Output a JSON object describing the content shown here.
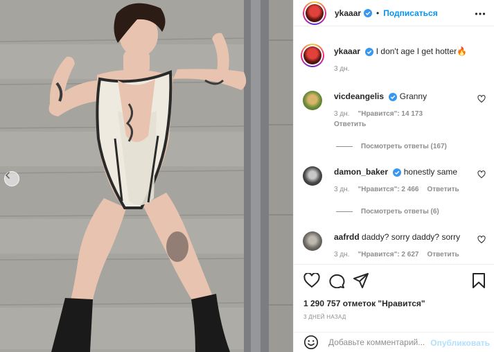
{
  "header": {
    "username": "ykaaar",
    "separator": "•",
    "follow_label": "Подписаться"
  },
  "caption": {
    "username": "ykaaar",
    "text": "I don't age I get hotter🔥",
    "time": "3 дн."
  },
  "comments": [
    {
      "username": "vicdeangelis",
      "verified": true,
      "text": "Granny",
      "time": "3 дн.",
      "likes": "\"Нравится\": 14 173",
      "reply_label": "Ответить",
      "view_replies": "Посмотреть ответы (167)"
    },
    {
      "username": "damon_baker",
      "verified": true,
      "text": "honestly same",
      "time": "3 дн.",
      "likes": "\"Нравится\": 2 466",
      "reply_label": "Ответить",
      "view_replies": "Посмотреть ответы (6)"
    },
    {
      "username": "aafrdd",
      "verified": false,
      "text": "daddy? sorry daddy? sorry",
      "time": "3 дн.",
      "likes": "\"Нравится\": 2 627",
      "reply_label": "Ответить"
    }
  ],
  "post": {
    "likes": "1 290 757 отметок \"Нравится\"",
    "time": "3 ДНЕЙ НАЗАД"
  },
  "add_comment": {
    "placeholder": "Добавьте комментарий...",
    "publish_label": "Опубликовать"
  },
  "icons": {
    "nav_prev": "chevron-left-icon",
    "more": "more-horizontal-icon",
    "like": "heart-icon",
    "comment": "comment-icon",
    "share": "share-icon",
    "save": "bookmark-icon",
    "emoji": "emoji-icon",
    "verified": "verified-badge-icon"
  },
  "colors": {
    "accent": "#0095f6",
    "publish_disabled": "#b2dffc",
    "muted": "#8e8e8e",
    "text": "#262626",
    "verified": "#3897f0"
  }
}
